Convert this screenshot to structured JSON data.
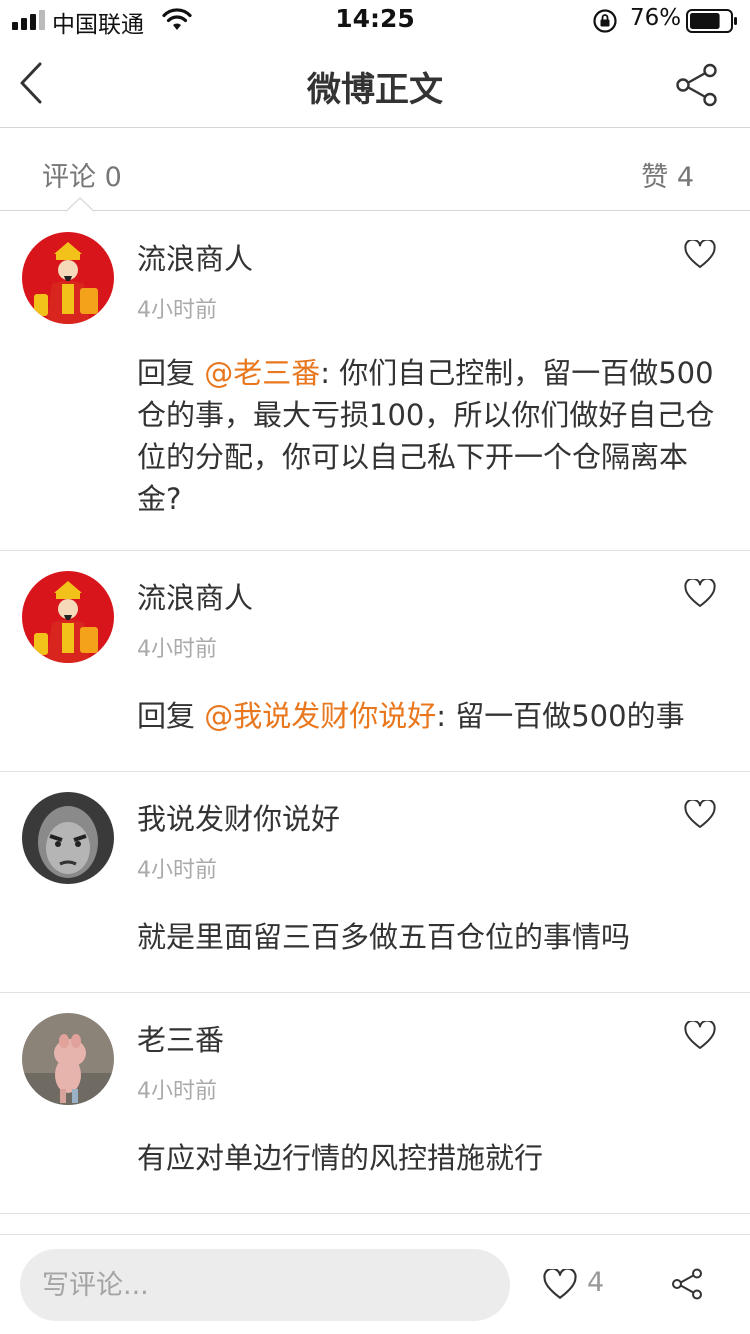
{
  "status_bar": {
    "carrier": "中国联通",
    "time": "14:25",
    "battery_percent": "76%",
    "battery_level": 0.76
  },
  "nav": {
    "title": "微博正文"
  },
  "tabs": {
    "comments": "评论 0",
    "likes": "赞 4"
  },
  "comments": [
    {
      "name": "流浪商人",
      "time": "4小时前",
      "prefix": "回复 ",
      "mention": "@老三番",
      "text": ": 你们自己控制，留一百做500仓的事，最大亏损100，所以你们做好自己仓位的分配，你可以自己私下开一个仓隔离本金?"
    },
    {
      "name": "流浪商人",
      "time": "4小时前",
      "prefix": "回复 ",
      "mention": "@我说发财你说好",
      "text": ": 留一百做500的事"
    },
    {
      "name": "我说发财你说好",
      "time": "4小时前",
      "text": "就是里面留三百多做五百仓位的事情吗"
    },
    {
      "name": "老三番",
      "time": "4小时前",
      "text": "有应对单边行情的风控措施就行"
    }
  ],
  "bottom_bar": {
    "input_placeholder": "写评论...",
    "like_count": "4"
  },
  "colors": {
    "mention": "#e8771e",
    "divider": "#d6d6d6"
  }
}
